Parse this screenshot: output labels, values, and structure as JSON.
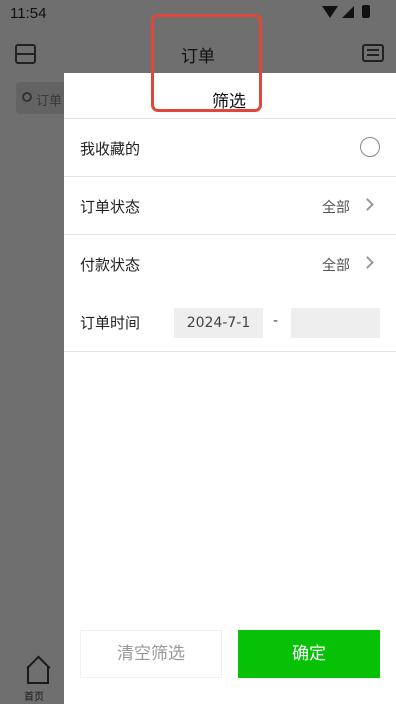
{
  "status_bar": {
    "time": "11:54"
  },
  "app": {
    "title": "订单",
    "search_placeholder": "订单"
  },
  "bottom_nav": {
    "home_label": "首页"
  },
  "filter_drawer": {
    "title": "筛选",
    "favorites_label": "我收藏的",
    "order_status_label": "订单状态",
    "order_status_value": "全部",
    "payment_status_label": "付款状态",
    "payment_status_value": "全部",
    "order_time_label": "订单时间",
    "start_date": "2024-7-1",
    "date_separator": "-",
    "end_date": "",
    "clear_button": "清空筛选",
    "confirm_button": "确定"
  },
  "colors": {
    "confirm_green": "#07c107",
    "highlight_red": "#e0463a"
  }
}
